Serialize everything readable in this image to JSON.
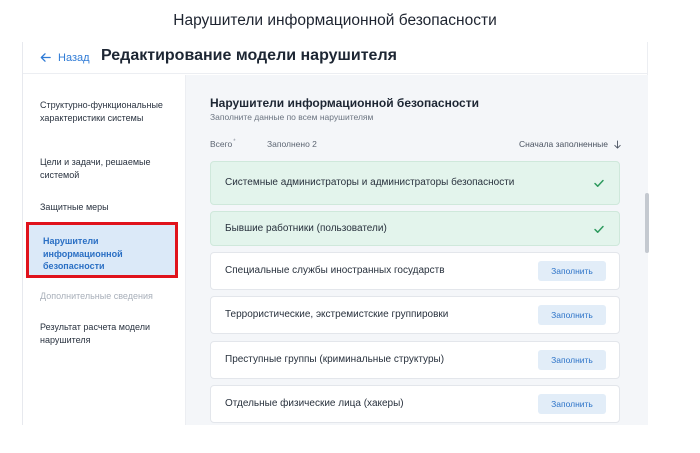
{
  "top_title": "Нарушители информационной безопасности",
  "header": {
    "back_label": "Назад",
    "title": "Редактирование модели нарушителя"
  },
  "sidebar": {
    "items": [
      {
        "label": "Структурно-функциональные характеристики системы",
        "state": "normal"
      },
      {
        "label": "Цели и задачи, решаемые системой",
        "state": "normal"
      },
      {
        "label": "Защитные меры",
        "state": "normal"
      },
      {
        "label": "Нарушители информационной безопасности",
        "state": "active"
      },
      {
        "label": "Дополнительные сведения",
        "state": "disabled"
      },
      {
        "label": "Результат расчета модели нарушителя",
        "state": "normal"
      }
    ]
  },
  "main": {
    "title": "Нарушители информационной безопасности",
    "subtitle": "Заполните данные по всем нарушителям",
    "filters": {
      "all_label": "Всего",
      "all_marker": "*",
      "filled_label": "Заполнено 2"
    },
    "sort_label": "Сначала заполненные",
    "fill_button_label": "Заполнить",
    "violators": [
      {
        "label": "Системные администраторы и администраторы безопасности",
        "filled": true
      },
      {
        "label": "Бывшие работники (пользователи)",
        "filled": true
      },
      {
        "label": "Специальные службы иностранных государств",
        "filled": false
      },
      {
        "label": "Террористические, экстремистские группировки",
        "filled": false
      },
      {
        "label": "Преступные группы (криминальные структуры)",
        "filled": false
      },
      {
        "label": "Отдельные физические лица (хакеры)",
        "filled": false
      }
    ]
  },
  "colors": {
    "accent": "#2f7bd6",
    "filled_card": "#e3f4ec",
    "check": "#2e9a5e",
    "highlight_box": "#e0121c"
  }
}
